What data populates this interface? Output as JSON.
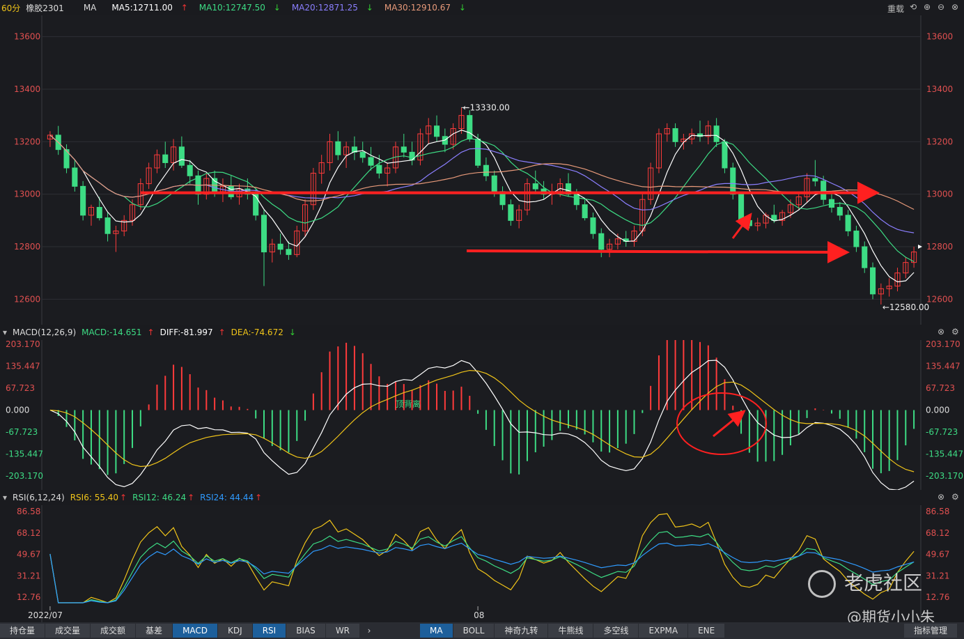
{
  "header": {
    "period": "60分",
    "symbol": "橡胶2301",
    "ind": "MA",
    "ma5": "MA5:12711.00",
    "ma10": "MA10:12747.50",
    "ma20": "MA20:12871.25",
    "ma30": "MA30:12910.67",
    "reload": "重载"
  },
  "macd_header": {
    "title": "MACD(12,26,9)",
    "macd": "MACD:-14.651",
    "diff": "DIFF:-81.997",
    "dea": "DEA:-74.672"
  },
  "rsi_header": {
    "title": "RSI(6,12,24)",
    "rsi6": "RSI6: 55.40",
    "rsi12": "RSI12: 46.24",
    "rsi24": "RSI24: 44.44"
  },
  "price_axis": [
    "13600",
    "13400",
    "13200",
    "13000",
    "12800",
    "12600"
  ],
  "macd_axis": [
    "203.170",
    "135.447",
    "67.723",
    "0.000",
    "-67.723",
    "-135.447",
    "-203.170"
  ],
  "rsi_axis": [
    "86.58",
    "68.12",
    "49.67",
    "31.21",
    "12.76"
  ],
  "x_labels": [
    "2022/07",
    "08"
  ],
  "annotations": {
    "high": "13330.00",
    "low": "12580.00",
    "macd_note": "顶背离"
  },
  "bottom_tabs": [
    "持仓量",
    "成交量",
    "成交额",
    "基差",
    "MACD",
    "KDJ",
    "RSI",
    "BIAS",
    "WR"
  ],
  "bottom_tabs2": [
    "MA",
    "BOLL",
    "神奇九转",
    "牛熊线",
    "多空线",
    "EXPMA",
    "ENE"
  ],
  "tools_label": "指标管理",
  "watermark": {
    "brand": "老虎社区",
    "user": "@期货小小朱"
  },
  "chart_data": [
    {
      "type": "candlestick",
      "ylim": [
        12540,
        13660
      ],
      "axis_ticks": [
        13600,
        13400,
        13200,
        13000,
        12800,
        12600
      ],
      "series": [
        {
          "name": "MA5",
          "color": "#ffffff"
        },
        {
          "name": "MA10",
          "color": "#3ddc84"
        },
        {
          "name": "MA20",
          "color": "#8b7fff"
        },
        {
          "name": "MA30",
          "color": "#e89a7a"
        }
      ],
      "candles": [
        [
          13210,
          13240,
          13180,
          13225
        ],
        [
          13225,
          13260,
          13150,
          13170
        ],
        [
          13170,
          13190,
          13080,
          13100
        ],
        [
          13100,
          13130,
          13010,
          13030
        ],
        [
          13030,
          13050,
          12900,
          12920
        ],
        [
          12920,
          12960,
          12880,
          12950
        ],
        [
          12950,
          12990,
          12900,
          12910
        ],
        [
          12910,
          12930,
          12820,
          12850
        ],
        [
          12850,
          12880,
          12780,
          12860
        ],
        [
          12860,
          12920,
          12840,
          12900
        ],
        [
          12900,
          12980,
          12880,
          12960
        ],
        [
          12960,
          13060,
          12940,
          13040
        ],
        [
          13040,
          13120,
          13020,
          13100
        ],
        [
          13100,
          13170,
          13080,
          13150
        ],
        [
          13150,
          13200,
          13100,
          13120
        ],
        [
          13120,
          13210,
          13090,
          13180
        ],
        [
          13180,
          13220,
          13100,
          13110
        ],
        [
          13110,
          13130,
          13040,
          13070
        ],
        [
          13070,
          13090,
          12960,
          13000
        ],
        [
          13000,
          13080,
          12980,
          13060
        ],
        [
          13060,
          13090,
          12990,
          13010
        ],
        [
          13010,
          13060,
          12970,
          13030
        ],
        [
          13030,
          13070,
          12980,
          12990
        ],
        [
          12990,
          13040,
          12960,
          13020
        ],
        [
          13020,
          13060,
          12980,
          13000
        ],
        [
          13000,
          13020,
          12900,
          12920
        ],
        [
          12920,
          12940,
          12650,
          12780
        ],
        [
          12780,
          12830,
          12740,
          12810
        ],
        [
          12810,
          12850,
          12770,
          12790
        ],
        [
          12790,
          12820,
          12750,
          12770
        ],
        [
          12770,
          12880,
          12760,
          12860
        ],
        [
          12860,
          12980,
          12840,
          12960
        ],
        [
          12960,
          13100,
          12940,
          13080
        ],
        [
          13080,
          13150,
          13040,
          13120
        ],
        [
          13120,
          13230,
          13090,
          13200
        ],
        [
          13200,
          13240,
          13130,
          13150
        ],
        [
          13150,
          13200,
          13100,
          13180
        ],
        [
          13180,
          13220,
          13130,
          13160
        ],
        [
          13160,
          13200,
          13120,
          13140
        ],
        [
          13140,
          13180,
          13090,
          13110
        ],
        [
          13110,
          13150,
          13060,
          13080
        ],
        [
          13080,
          13120,
          13030,
          13100
        ],
        [
          13100,
          13200,
          13080,
          13180
        ],
        [
          13180,
          13230,
          13140,
          13160
        ],
        [
          13160,
          13200,
          13110,
          13130
        ],
        [
          13130,
          13250,
          13110,
          13230
        ],
        [
          13230,
          13290,
          13190,
          13260
        ],
        [
          13260,
          13300,
          13200,
          13220
        ],
        [
          13220,
          13250,
          13160,
          13190
        ],
        [
          13190,
          13270,
          13170,
          13250
        ],
        [
          13250,
          13330,
          13230,
          13300
        ],
        [
          13300,
          13320,
          13200,
          13210
        ],
        [
          13210,
          13230,
          13100,
          13110
        ],
        [
          13110,
          13140,
          13050,
          13070
        ],
        [
          13070,
          13090,
          12990,
          13010
        ],
        [
          13010,
          13030,
          12940,
          12960
        ],
        [
          12960,
          12980,
          12880,
          12900
        ],
        [
          12900,
          12960,
          12870,
          12940
        ],
        [
          12940,
          13060,
          12920,
          13040
        ],
        [
          13040,
          13090,
          13000,
          13020
        ],
        [
          13020,
          13050,
          12980,
          13000
        ],
        [
          13000,
          13040,
          12960,
          13010
        ],
        [
          13010,
          13060,
          12990,
          13040
        ],
        [
          13040,
          13080,
          12990,
          13000
        ],
        [
          13000,
          13020,
          12940,
          12960
        ],
        [
          12960,
          12980,
          12900,
          12910
        ],
        [
          12910,
          12930,
          12830,
          12850
        ],
        [
          12850,
          12870,
          12760,
          12790
        ],
        [
          12790,
          12830,
          12760,
          12810
        ],
        [
          12810,
          12850,
          12790,
          12830
        ],
        [
          12830,
          12860,
          12800,
          12820
        ],
        [
          12820,
          12880,
          12800,
          12860
        ],
        [
          12860,
          13000,
          12840,
          12980
        ],
        [
          12980,
          13120,
          12960,
          13100
        ],
        [
          13100,
          13250,
          13080,
          13230
        ],
        [
          13230,
          13270,
          13200,
          13250
        ],
        [
          13250,
          13270,
          13180,
          13200
        ],
        [
          13200,
          13230,
          13170,
          13210
        ],
        [
          13210,
          13250,
          13190,
          13230
        ],
        [
          13230,
          13280,
          13200,
          13220
        ],
        [
          13220,
          13280,
          13190,
          13260
        ],
        [
          13260,
          13290,
          13180,
          13200
        ],
        [
          13200,
          13210,
          13080,
          13100
        ],
        [
          13100,
          13120,
          12980,
          13000
        ],
        [
          13000,
          13010,
          12880,
          12900
        ],
        [
          12900,
          12920,
          12870,
          12880
        ],
        [
          12880,
          12910,
          12860,
          12890
        ],
        [
          12890,
          12930,
          12870,
          12920
        ],
        [
          12920,
          12960,
          12890,
          12900
        ],
        [
          12900,
          12940,
          12880,
          12930
        ],
        [
          12930,
          12980,
          12910,
          12960
        ],
        [
          12960,
          13000,
          12940,
          12990
        ],
        [
          12990,
          13080,
          12970,
          13060
        ],
        [
          13060,
          13130,
          13030,
          13050
        ],
        [
          13050,
          13070,
          12960,
          12980
        ],
        [
          12980,
          13000,
          12930,
          12950
        ],
        [
          12950,
          12970,
          12900,
          12920
        ],
        [
          12920,
          12940,
          12840,
          12860
        ],
        [
          12860,
          12880,
          12780,
          12800
        ],
        [
          12800,
          12820,
          12700,
          12720
        ],
        [
          12720,
          12740,
          12600,
          12620
        ],
        [
          12620,
          12660,
          12580,
          12640
        ],
        [
          12640,
          12680,
          12610,
          12650
        ],
        [
          12650,
          12720,
          12630,
          12700
        ],
        [
          12700,
          12760,
          12680,
          12740
        ],
        [
          12740,
          12800,
          12720,
          12780
        ]
      ]
    },
    {
      "type": "bar+line",
      "ylim": [
        -203.17,
        203.17
      ],
      "axis_ticks": [
        203.17,
        135.447,
        67.723,
        0,
        -67.723,
        -135.447,
        -203.17
      ],
      "series": [
        {
          "name": "DIFF",
          "color": "#ffffff"
        },
        {
          "name": "DEA",
          "color": "#f0c419"
        },
        {
          "name": "MACD",
          "color": "mixed"
        }
      ]
    },
    {
      "type": "line",
      "ylim": [
        5,
        92
      ],
      "axis_ticks": [
        86.58,
        68.12,
        49.67,
        31.21,
        12.76
      ],
      "series": [
        {
          "name": "RSI6",
          "color": "#f0c419"
        },
        {
          "name": "RSI12",
          "color": "#3ddc84"
        },
        {
          "name": "RSI24",
          "color": "#2f9bff"
        }
      ]
    }
  ]
}
